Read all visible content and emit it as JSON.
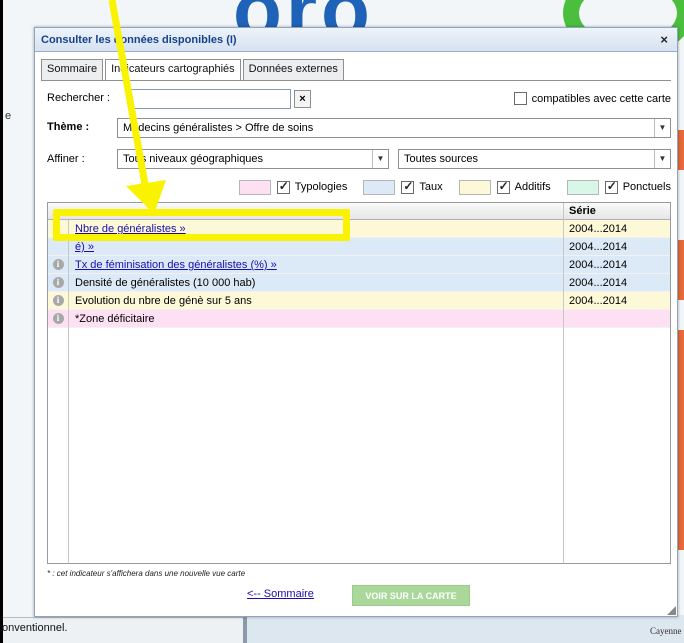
{
  "background": {
    "bottom_text": "onventionnel.",
    "map_label": "Cayenne"
  },
  "dialog": {
    "title": "Consulter les données disponibles (I)",
    "close_symbol": "×",
    "tabs": [
      {
        "label": "Sommaire",
        "active": false
      },
      {
        "label": "Indicateurs cartographiés",
        "active": true
      },
      {
        "label": "Données externes",
        "active": false
      }
    ],
    "search": {
      "label": "Rechercher :",
      "value": "",
      "clear_symbol": "×",
      "compatible_label": "compatibles avec cette carte",
      "compatible_checked": false
    },
    "theme": {
      "label": "Thème :",
      "value": "Médecins généralistes > Offre de soins"
    },
    "affiner": {
      "label": "Affiner :",
      "level_value": "Tous niveaux géographiques",
      "source_value": "Toutes sources"
    },
    "legend": [
      {
        "label": "Typologies",
        "color": "#fde0f2",
        "checked": true
      },
      {
        "label": "Taux",
        "color": "#dce9f7",
        "checked": true
      },
      {
        "label": "Additifs",
        "color": "#fdf8d8",
        "checked": true
      },
      {
        "label": "Ponctuels",
        "color": "#d8f7e9",
        "checked": true
      }
    ],
    "grid": {
      "serie_header": "Série",
      "rows": [
        {
          "label": "Nbre de généralistes »",
          "serie": "2004...2014",
          "link": true,
          "info": false,
          "color": "#fdf8d8"
        },
        {
          "label": "é) »",
          "serie": "2004...2014",
          "link": true,
          "info": false,
          "color": "#dce9f7"
        },
        {
          "label": "Tx de féminisation des généralistes (%) »",
          "serie": "2004...2014",
          "link": true,
          "info": true,
          "color": "#dce9f7"
        },
        {
          "label": "Densité de généralistes (10 000 hab)",
          "serie": "2004...2014",
          "link": false,
          "info": true,
          "color": "#dce9f7"
        },
        {
          "label": "Evolution du nbre de génè sur 5 ans",
          "serie": "2004...2014",
          "link": false,
          "info": true,
          "color": "#fdf8d8"
        },
        {
          "label": "*Zone déficitaire",
          "serie": "",
          "link": false,
          "info": true,
          "color": "#fde0f2"
        }
      ]
    },
    "footnote": "* : cet indicateur s'affichera dans une nouvelle vue carte",
    "sommaire_link": "<-- Sommaire",
    "voir_button": "VOIR SUR LA CARTE"
  },
  "annotation": {
    "color": "#f9f200"
  }
}
